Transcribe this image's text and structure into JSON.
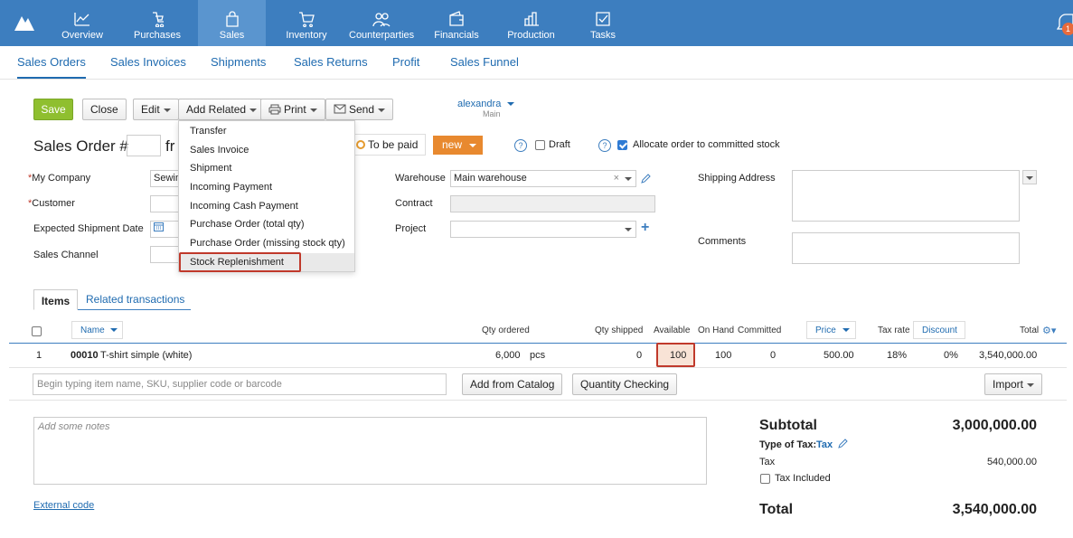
{
  "nav": {
    "items": [
      {
        "label": "Overview",
        "icon": "chart-line-icon"
      },
      {
        "label": "Purchases",
        "icon": "purchases-icon"
      },
      {
        "label": "Sales",
        "icon": "shopping-bag-icon"
      },
      {
        "label": "Inventory",
        "icon": "cart-icon"
      },
      {
        "label": "Counterparties",
        "icon": "people-icon"
      },
      {
        "label": "Financials",
        "icon": "wallet-icon"
      },
      {
        "label": "Production",
        "icon": "factory-icon"
      },
      {
        "label": "Tasks",
        "icon": "checkbox-icon"
      }
    ],
    "notification_count": "1"
  },
  "subnav": {
    "tabs": [
      "Sales Orders",
      "Sales Invoices",
      "Shipments",
      "Sales Returns",
      "Profit",
      "Sales Funnel"
    ]
  },
  "toolbar": {
    "save": "Save",
    "close": "Close",
    "edit": "Edit",
    "add_related": "Add Related",
    "print": "Print",
    "send": "Send",
    "user": "alexandra",
    "user_sub": "Main"
  },
  "add_related_menu": [
    "Transfer",
    "Sales Invoice",
    "Shipment",
    "Incoming Payment",
    "Incoming Cash Payment",
    "Purchase Order (total qty)",
    "Purchase Order (missing stock qty)",
    "Stock Replenishment"
  ],
  "header": {
    "title": "Sales Order #",
    "from_partial": "fr",
    "to_be_paid": "To be paid",
    "status": "new",
    "draft_label": "Draft",
    "allocate_label": "Allocate order to committed stock"
  },
  "form": {
    "my_company_label": "My Company",
    "my_company_value": "Sewin",
    "customer_label": "Customer",
    "expected_shipment_label": "Expected Shipment Date",
    "sales_channel_label": "Sales Channel",
    "warehouse_label": "Warehouse",
    "warehouse_value": "Main warehouse",
    "contract_label": "Contract",
    "project_label": "Project",
    "shipping_address_label": "Shipping Address",
    "comments_label": "Comments"
  },
  "tabs": {
    "items": "Items",
    "related": "Related transactions"
  },
  "table": {
    "headers": {
      "name": "Name",
      "qty_ordered": "Qty ordered",
      "qty_shipped": "Qty shipped",
      "available": "Available",
      "on_hand": "On Hand",
      "committed": "Committed",
      "price": "Price",
      "tax_rate": "Tax rate",
      "discount": "Discount",
      "total": "Total"
    },
    "rows": [
      {
        "num": "1",
        "code": "00010",
        "name": "T-shirt simple (white)",
        "qty_ordered": "6,000",
        "unit": "pcs",
        "qty_shipped": "0",
        "available": "100",
        "on_hand": "100",
        "committed": "0",
        "price": "500.00",
        "tax_rate": "18%",
        "discount": "0%",
        "total": "3,540,000.00"
      }
    ],
    "add_placeholder": "Begin typing item name, SKU, supplier code or barcode",
    "add_from_catalog": "Add from Catalog",
    "quantity_checking": "Quantity Checking",
    "import": "Import"
  },
  "notes_placeholder": "Add some notes",
  "external_code": "External code",
  "summary": {
    "subtotal_label": "Subtotal",
    "subtotal": "3,000,000.00",
    "type_of_tax_label": "Type of Tax:",
    "type_of_tax_value": "Tax",
    "tax_label": "Tax",
    "tax": "540,000.00",
    "tax_included_label": "Tax Included",
    "total_label": "Total",
    "total": "3,540,000.00"
  },
  "colors": {
    "nav_bg": "#3d7ebf",
    "link": "#1f6bb0",
    "save_green": "#8fbf2f",
    "status_orange": "#e8892f",
    "highlight_red": "#c0392b"
  }
}
